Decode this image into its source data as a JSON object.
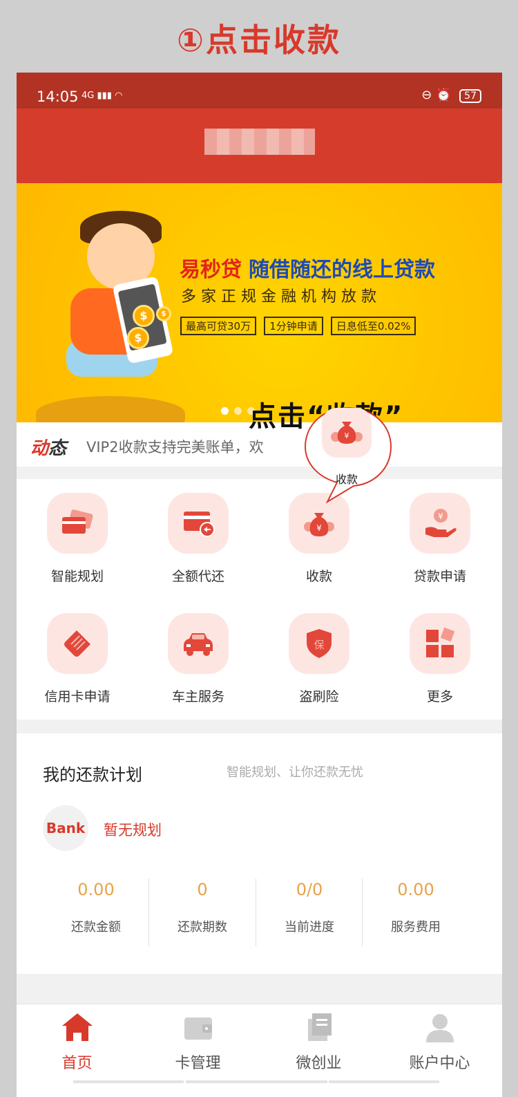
{
  "step_title": "①点击收款",
  "status_bar": {
    "time": "14:05",
    "signal": "4G",
    "battery": "57"
  },
  "banner": {
    "brand": "易秒贷",
    "headline": "随借随还的线上贷款",
    "subline": "多家正规金融机构放款",
    "tags": [
      "最高可贷30万",
      "1分钟申请",
      "日息低至0.02%"
    ]
  },
  "news": {
    "tag_a": "动",
    "tag_b": "态",
    "text": "VIP2收款支持完美账单，欢"
  },
  "grid": [
    {
      "label": "智能规划",
      "icon": "cards-icon"
    },
    {
      "label": "全额代还",
      "icon": "card-return-icon"
    },
    {
      "label": "收款",
      "icon": "money-bag-icon"
    },
    {
      "label": "贷款申请",
      "icon": "hand-coin-icon"
    },
    {
      "label": "信用卡申请",
      "icon": "card-pen-icon"
    },
    {
      "label": "车主服务",
      "icon": "car-icon"
    },
    {
      "label": "盗刷险",
      "icon": "shield-icon"
    },
    {
      "label": "更多",
      "icon": "more-icon"
    }
  ],
  "plan": {
    "title": "我的还款计划",
    "subtitle": "智能规划、让你还款无忧",
    "bank_label": "Bank",
    "empty_text": "暂无规划",
    "stats": [
      {
        "value": "0.00",
        "label": "还款金额"
      },
      {
        "value": "0",
        "label": "还款期数"
      },
      {
        "value": "0/0",
        "label": "当前进度"
      },
      {
        "value": "0.00",
        "label": "服务费用"
      }
    ]
  },
  "tabs": [
    {
      "label": "首页",
      "icon": "home-icon",
      "active": true
    },
    {
      "label": "卡管理",
      "icon": "wallet-icon",
      "active": false
    },
    {
      "label": "微创业",
      "icon": "document-icon",
      "active": false
    },
    {
      "label": "账户中心",
      "icon": "user-icon",
      "active": false
    }
  ],
  "callout": {
    "text": "点击“收款”",
    "bubble_label": "收款"
  },
  "colors": {
    "primary": "#d8392b",
    "status_bar": "#b23223",
    "accent_value": "#e6a34a",
    "icon_bg": "#fde6e2"
  }
}
